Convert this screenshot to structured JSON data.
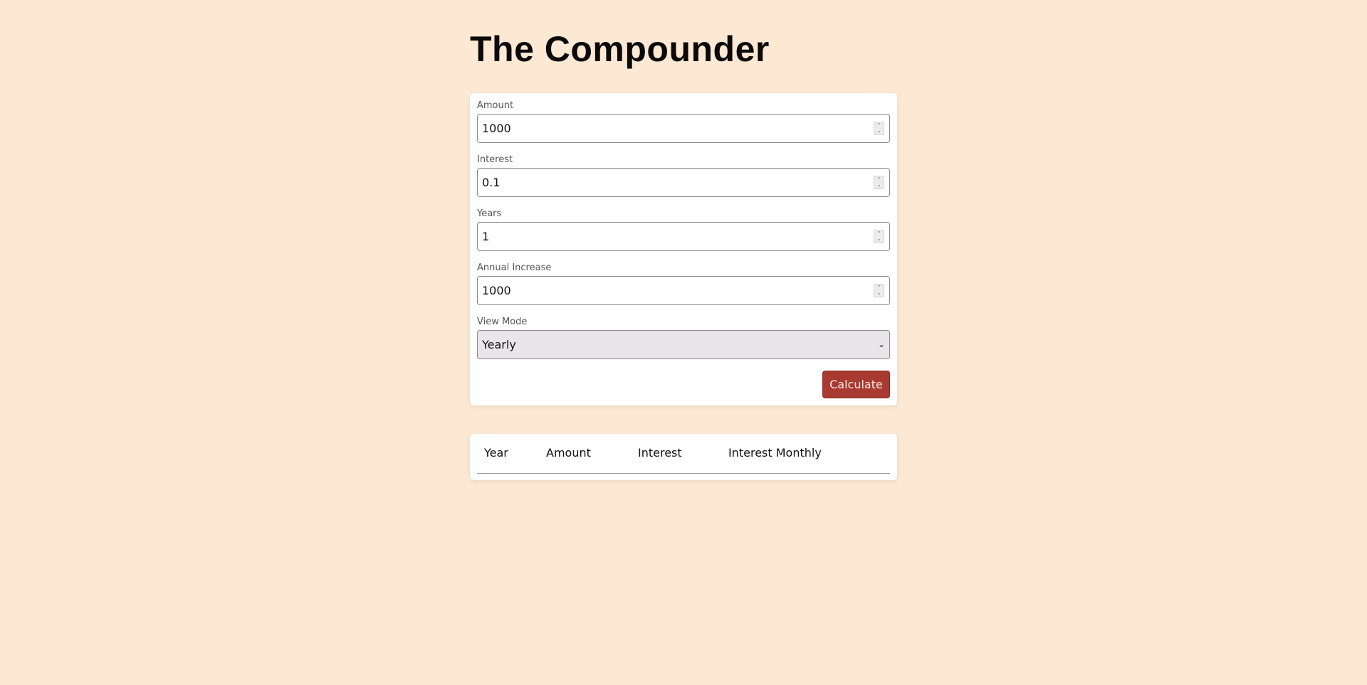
{
  "header": {
    "title": "The Compounder"
  },
  "form": {
    "amount": {
      "label": "Amount",
      "value": "1000"
    },
    "interest": {
      "label": "Interest",
      "value": "0.1"
    },
    "years": {
      "label": "Years",
      "value": "1"
    },
    "annual_increase": {
      "label": "Annual Increase",
      "value": "1000"
    },
    "view_mode": {
      "label": "View Mode",
      "selected": "Yearly"
    },
    "calculate_label": "Calculate",
    "spinner_up": "⌃",
    "spinner_down": "⌄",
    "chevron": "⌄"
  },
  "results_table": {
    "columns": [
      "Year",
      "Amount",
      "Interest",
      "Interest Monthly"
    ],
    "rows": []
  },
  "colors": {
    "background": "#fde8d3",
    "card": "#ffffff",
    "accent_button": "#a93a32",
    "select_background": "#e8e6e8"
  }
}
